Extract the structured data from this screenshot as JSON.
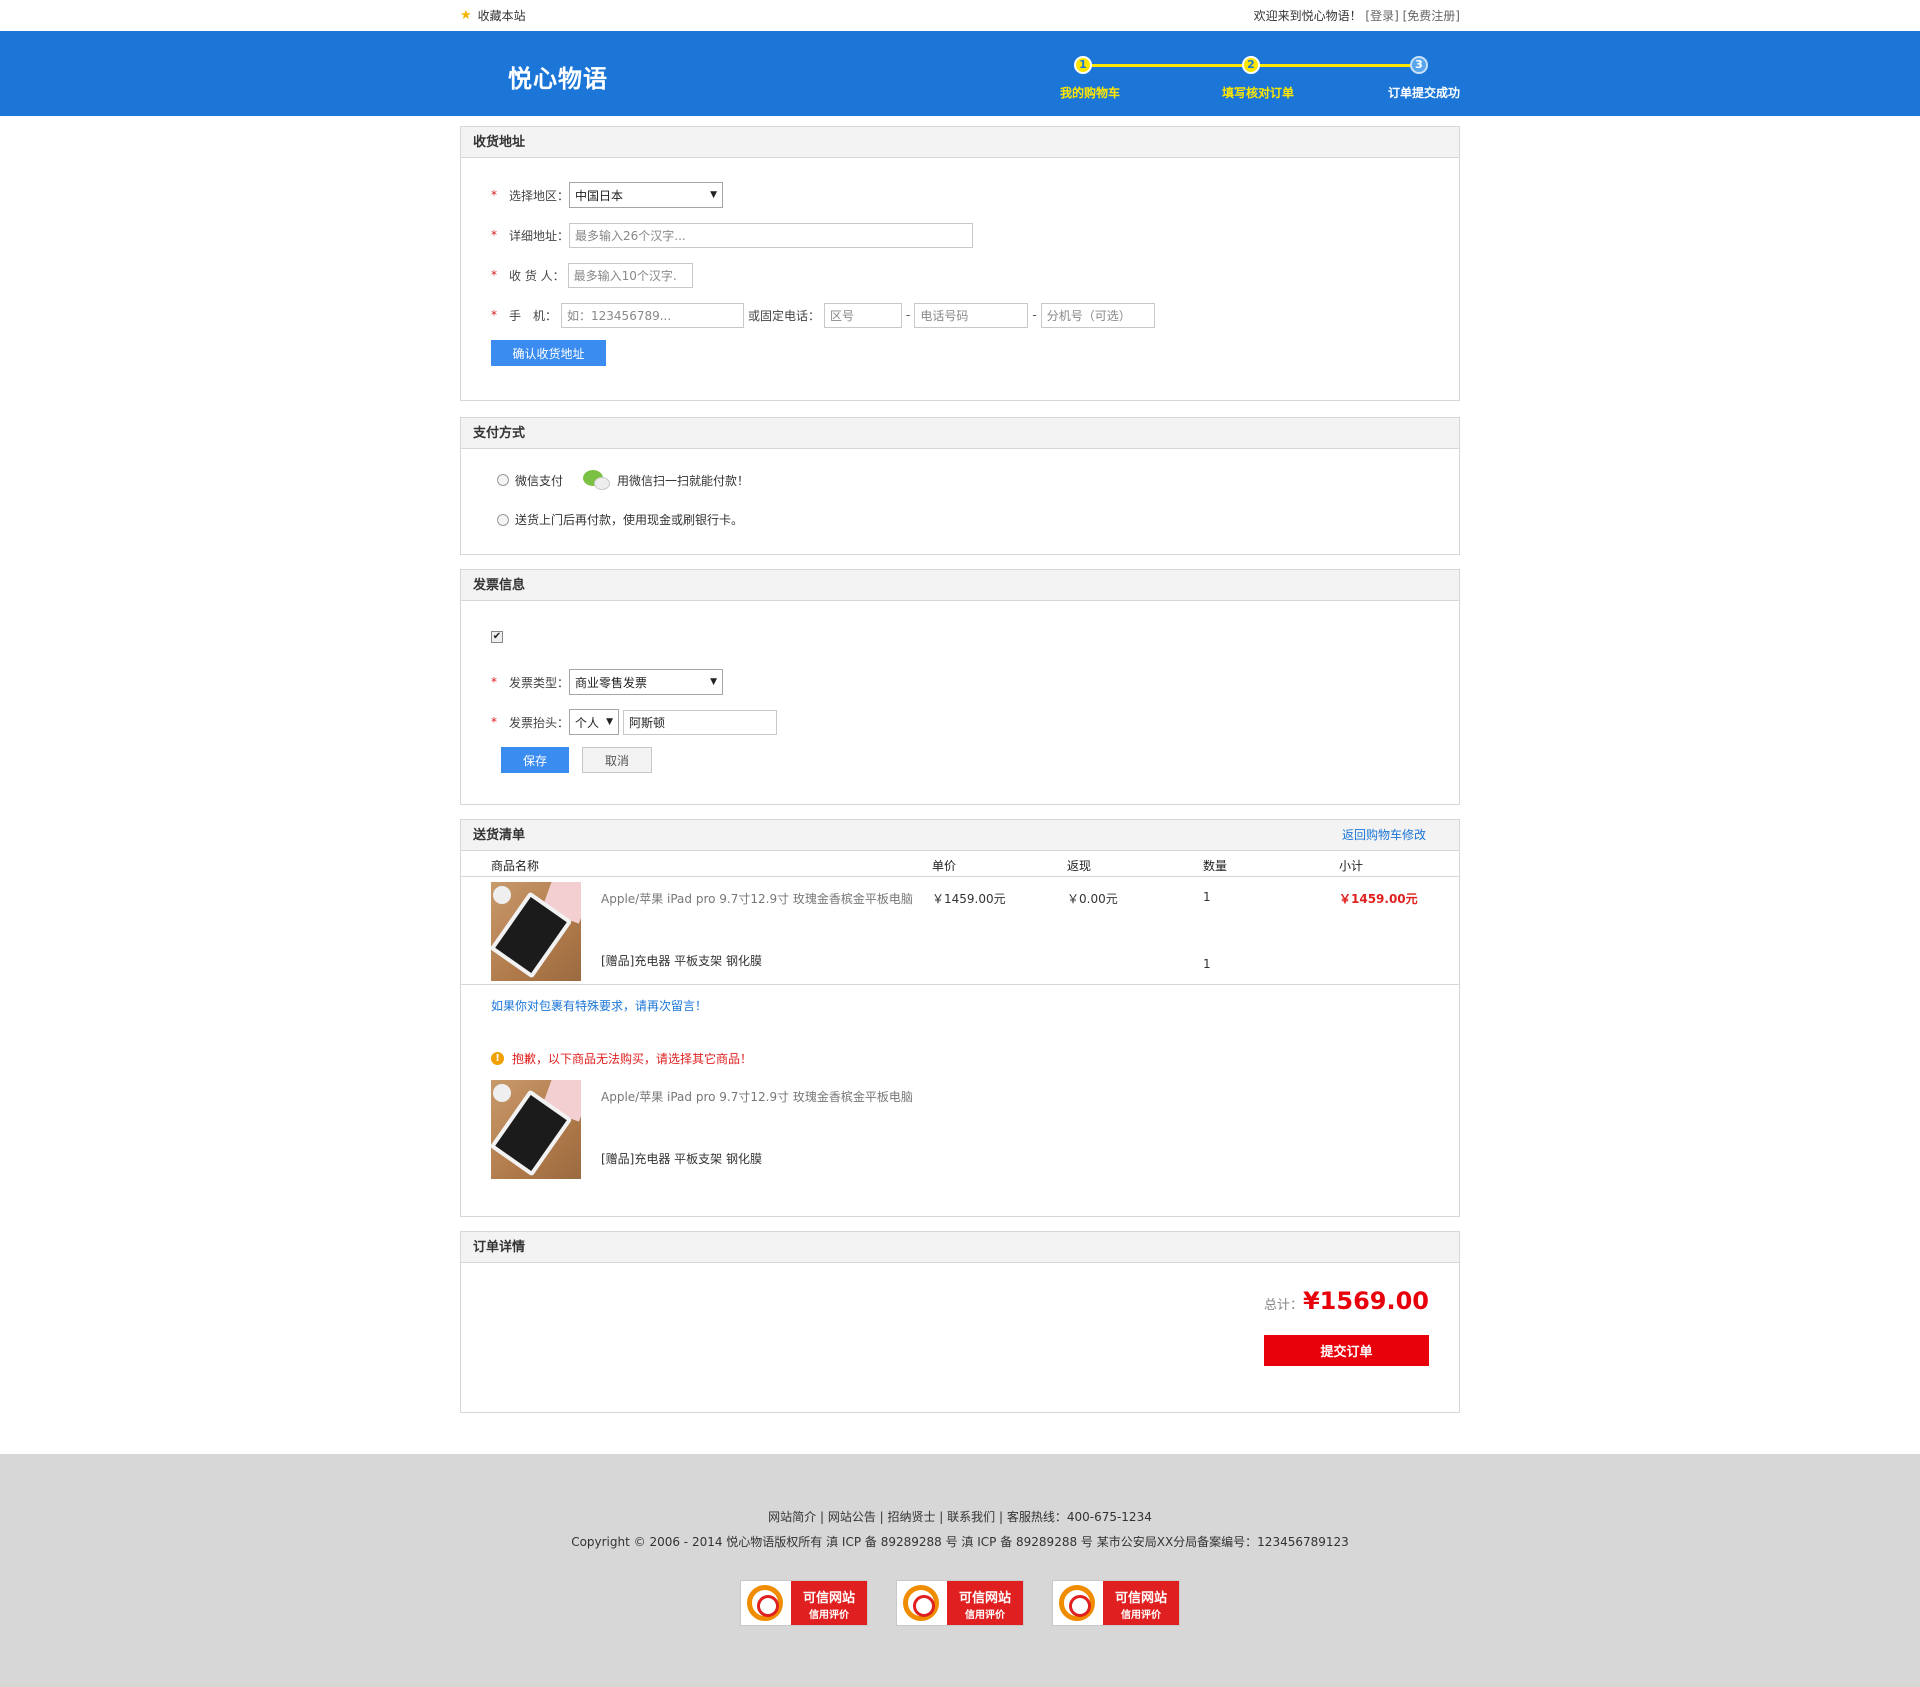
{
  "topbar": {
    "favorite": "收藏本站",
    "welcome": "欢迎来到悦心物语！",
    "login": "[登录]",
    "register": "[免费注册]"
  },
  "header": {
    "logo": "悦心物语",
    "steps": [
      {
        "num": "1",
        "label": "我的购物车"
      },
      {
        "num": "2",
        "label": "填写核对订单"
      },
      {
        "num": "3",
        "label": "订单提交成功"
      }
    ]
  },
  "address": {
    "title": "收货地址",
    "region_label": "选择地区：",
    "region_value": "中国日本",
    "detail_label": "详细地址：",
    "detail_placeholder": "最多输入26个汉字...",
    "receiver_label": "收 货 人：",
    "receiver_placeholder": "最多输入10个汉字.",
    "mobile_label": "手　机：",
    "mobile_placeholder": "如：123456789...",
    "phone_label": "或固定电话：",
    "area_placeholder": "区号",
    "phone_placeholder": "电话号码",
    "ext_placeholder": "分机号（可选）",
    "dash": "-",
    "confirm_button": "确认收货地址",
    "required_mark": "*"
  },
  "payment": {
    "title": "支付方式",
    "wechat_label": "微信支付",
    "wechat_hint": "用微信扫一扫就能付款！",
    "cod_label": "送货上门后再付款，使用现金或刷银行卡。"
  },
  "invoice": {
    "title": "发票信息",
    "checked": "✔",
    "type_label": "发票类型：",
    "type_value": "商业零售发票",
    "header_label": "发票抬头：",
    "header_type": "个人",
    "header_value": "阿斯顿",
    "save_button": "保存",
    "cancel_button": "取消"
  },
  "delivery": {
    "title": "送货清单",
    "back_link": "返回购物车修改",
    "columns": {
      "name": "商品名称",
      "price": "单价",
      "cashback": "返现",
      "qty": "数量",
      "subtotal": "小计"
    },
    "item": {
      "title": "Apple/苹果 iPad pro 9.7寸12.9寸 玫瑰金香槟金平板电脑",
      "price": "￥1459.00元",
      "cashback": "￥0.00元",
      "qty": "1",
      "subtotal": "￥1459.00元",
      "gift": "[赠品]充电器 平板支架 钢化膜",
      "gift_qty": "1"
    },
    "note_link": "如果你对包裹有特殊要求，请再次留言！",
    "warning": "抱歉，以下商品无法购买，请选择其它商品！",
    "unavailable": {
      "title": "Apple/苹果 iPad pro 9.7寸12.9寸 玫瑰金香槟金平板电脑",
      "gift": "[赠品]充电器 平板支架 钢化膜"
    }
  },
  "order": {
    "title": "订单详情",
    "total_label": "总计：",
    "total_value": "¥1569.00",
    "submit_button": "提交订单"
  },
  "footer": {
    "links": "网站简介 | 网站公告 | 招纳贤士 | 联系我们 | 客服热线：400-675-1234",
    "copyright": "Copyright © 2006 - 2014 悦心物语版权所有   滇 ICP 备 89289288 号   滇 ICP 备 89289288 号   某市公安局XX分局备案编号：123456789123",
    "badges": [
      {
        "line1": "可信网站",
        "line2": "信用评价"
      },
      {
        "line1": "可信网站",
        "line2": "信用评价"
      },
      {
        "line1": "可信网站",
        "line2": "信用评价"
      }
    ]
  },
  "colors": {
    "brand_blue": "#1b76d8",
    "step_yellow": "#ffe600",
    "price_red": "#e02020",
    "submit_red": "#e8000b"
  }
}
